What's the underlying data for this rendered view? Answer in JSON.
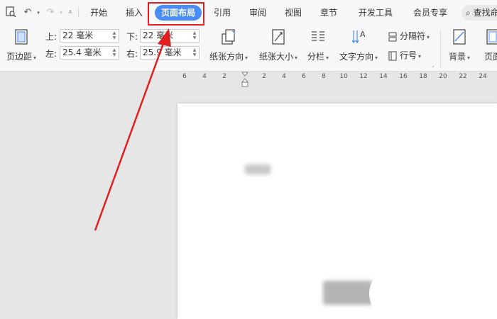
{
  "quick_access": {
    "icons": [
      "preview-icon",
      "undo-icon",
      "redo-icon",
      "customize-icon"
    ]
  },
  "tabs": [
    {
      "label": "开始"
    },
    {
      "label": "插入"
    },
    {
      "label": "页面布局",
      "active": true
    },
    {
      "label": "引用"
    },
    {
      "label": "审阅"
    },
    {
      "label": "视图"
    },
    {
      "label": "章节"
    },
    {
      "label": "开发工具"
    },
    {
      "label": "会员专享"
    }
  ],
  "search": {
    "label": "查找命令"
  },
  "ribbon": {
    "margins_label": "页边距",
    "top_label": "上:",
    "top_value": "22 毫米",
    "left_label": "左:",
    "left_value": "25.4 毫米",
    "bottom_label": "下:",
    "bottom_value": "22 毫米",
    "right_label": "右:",
    "right_value": "25.9 毫米",
    "orientation_label": "纸张方向",
    "size_label": "纸张大小",
    "columns_label": "分栏",
    "text_direction_label": "文字方向",
    "breaks_label": "分隔符",
    "line_numbers_label": "行号",
    "background_label": "背景",
    "page_border_label": "页面"
  },
  "ruler": {
    "ticks": [
      "6",
      "4",
      "2",
      "2",
      "4",
      "6",
      "8",
      "10",
      "12",
      "14",
      "16",
      "18",
      "20",
      "22",
      "24"
    ]
  },
  "colors": {
    "accent": "#4a8df8",
    "annotation": "#e02020"
  }
}
